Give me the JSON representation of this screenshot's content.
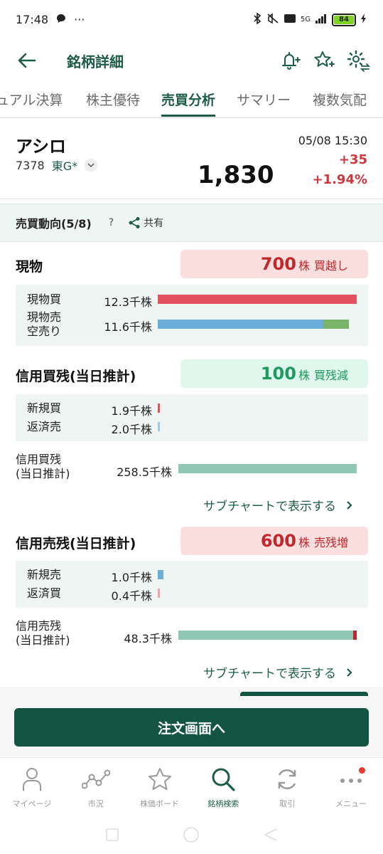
{
  "status_bar": {
    "time": "17:48",
    "dots": "···",
    "network": "5G",
    "battery": "84"
  },
  "header": {
    "title": "銘柄詳細"
  },
  "tabs": [
    {
      "label": "ュアル決算"
    },
    {
      "label": "株主優待"
    },
    {
      "label": "売買分析"
    },
    {
      "label": "サマリー"
    },
    {
      "label": "複数気配"
    }
  ],
  "stock": {
    "name": "アシロ",
    "code": "7378",
    "market": "東G*",
    "price": "1,830",
    "datetime": "05/08 15:30",
    "change": "+35",
    "change_pct": "+1.94%"
  },
  "trend": {
    "title": "売買動向(5/8)",
    "help": "?",
    "share_label": "共有"
  },
  "genbutsu": {
    "title": "現物",
    "badge_value": "700",
    "badge_unit": "株",
    "badge_label": "買越し",
    "rows": [
      {
        "label": "現物買",
        "value": "12.3千株",
        "fraction": 1.0
      },
      {
        "label": "現物売\n空売り",
        "value": "11.6千株",
        "fraction": 0.96
      }
    ]
  },
  "margin_buy": {
    "title": "信用買残(当日推計)",
    "badge_value": "100",
    "badge_unit": "株",
    "badge_label": "買残減",
    "rows": [
      {
        "label": "新規買",
        "value": "1.9千株"
      },
      {
        "label": "返済売",
        "value": "2.0千株"
      }
    ],
    "balance_label": "信用買残\n(当日推計)",
    "balance_value": "258.5千株",
    "sub_link": "サブチャートで表示する"
  },
  "margin_sell": {
    "title": "信用売残(当日推計)",
    "badge_value": "600",
    "badge_unit": "株",
    "badge_label": "売残増",
    "rows": [
      {
        "label": "新規売",
        "value": "1.0千株"
      },
      {
        "label": "返済買",
        "value": "0.4千株"
      }
    ],
    "balance_label": "信用売残\n(当日推計)",
    "balance_value": "48.3千株",
    "sub_link": "サブチャートで表示する"
  },
  "order_button": "注文画面へ",
  "bottom_nav": [
    {
      "label": "マイページ",
      "icon": "person-icon"
    },
    {
      "label": "市況",
      "icon": "chart-icon"
    },
    {
      "label": "株価ボード",
      "icon": "star-icon"
    },
    {
      "label": "銘柄検索",
      "icon": "search-icon"
    },
    {
      "label": "取引",
      "icon": "refresh-icon"
    },
    {
      "label": "メニュー",
      "icon": "more-icon"
    }
  ],
  "colors": {
    "brand": "#1d5c45",
    "red": "#d0363b",
    "buy_bar": "#e5525f",
    "sell_bar": "#6aaedb",
    "short_bar": "#7ab36a",
    "balance_bar": "#8fc7b4"
  }
}
